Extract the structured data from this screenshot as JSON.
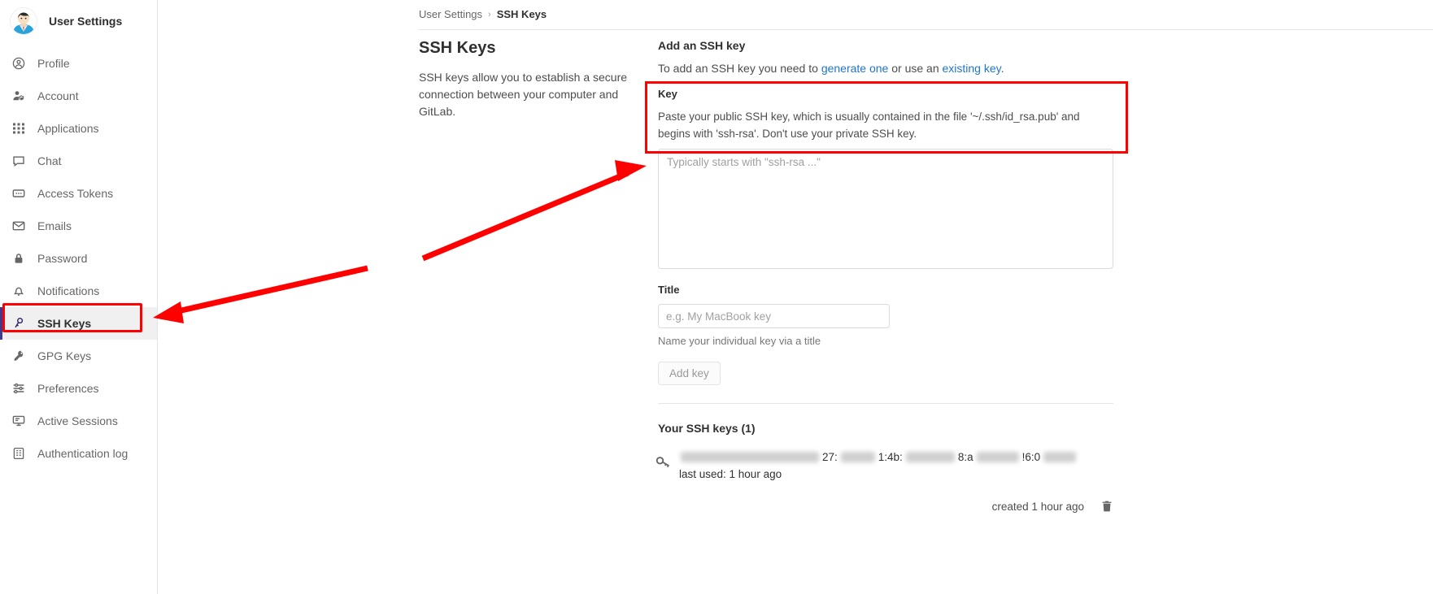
{
  "sidebar": {
    "title": "User Settings",
    "avatar_icon": "user-avatar",
    "items": [
      {
        "label": "Profile",
        "icon": "profile-icon",
        "active": false
      },
      {
        "label": "Account",
        "icon": "account-icon",
        "active": false
      },
      {
        "label": "Applications",
        "icon": "applications-grid-icon",
        "active": false
      },
      {
        "label": "Chat",
        "icon": "chat-bubble-icon",
        "active": false
      },
      {
        "label": "Access Tokens",
        "icon": "token-icon",
        "active": false
      },
      {
        "label": "Emails",
        "icon": "envelope-icon",
        "active": false
      },
      {
        "label": "Password",
        "icon": "lock-icon",
        "active": false
      },
      {
        "label": "Notifications",
        "icon": "bell-icon",
        "active": false
      },
      {
        "label": "SSH Keys",
        "icon": "key-icon",
        "active": true
      },
      {
        "label": "GPG Keys",
        "icon": "key-icon",
        "active": false
      },
      {
        "label": "Preferences",
        "icon": "sliders-icon",
        "active": false
      },
      {
        "label": "Active Sessions",
        "icon": "monitor-icon",
        "active": false
      },
      {
        "label": "Authentication log",
        "icon": "log-book-icon",
        "active": false
      }
    ]
  },
  "breadcrumb": {
    "root": "User Settings",
    "separator": "›",
    "current": "SSH Keys"
  },
  "page": {
    "title": "SSH Keys",
    "description": "SSH keys allow you to establish a secure connection between your computer and GitLab."
  },
  "form": {
    "heading": "Add an SSH key",
    "intro_prefix": "To add an SSH key you need to ",
    "intro_link1": "generate one",
    "intro_middle": " or use an ",
    "intro_link2": "existing key",
    "intro_suffix": ".",
    "key_label": "Key",
    "key_help": "Paste your public SSH key, which is usually contained in the file '~/.ssh/id_rsa.pub' and begins with 'ssh-rsa'. Don't use your private SSH key.",
    "key_placeholder": "Typically starts with \"ssh-rsa ...\"",
    "key_value": "",
    "title_label": "Title",
    "title_placeholder": "e.g. My MacBook key",
    "title_value": "",
    "title_help": "Name your individual key via a title",
    "submit_label": "Add key"
  },
  "keys_section": {
    "heading": "Your SSH keys (1)",
    "key_icon": "key-icon",
    "fingerprint_fragments": [
      "27:",
      "1:4b:",
      "8:a",
      "!6:0"
    ],
    "last_used": "last used: 1 hour ago",
    "created": "created 1 hour ago",
    "delete_icon": "trash-icon"
  },
  "annotations": {
    "highlight_color": "#ff0000",
    "arrow_to_sidebar": "red-arrow-pointing-to-ssh-keys-nav",
    "arrow_to_textarea": "red-arrow-pointing-to-key-textarea",
    "box_sidebar": "red-box-around-ssh-keys-nav-item",
    "box_key_help": "red-box-around-key-field-help"
  }
}
